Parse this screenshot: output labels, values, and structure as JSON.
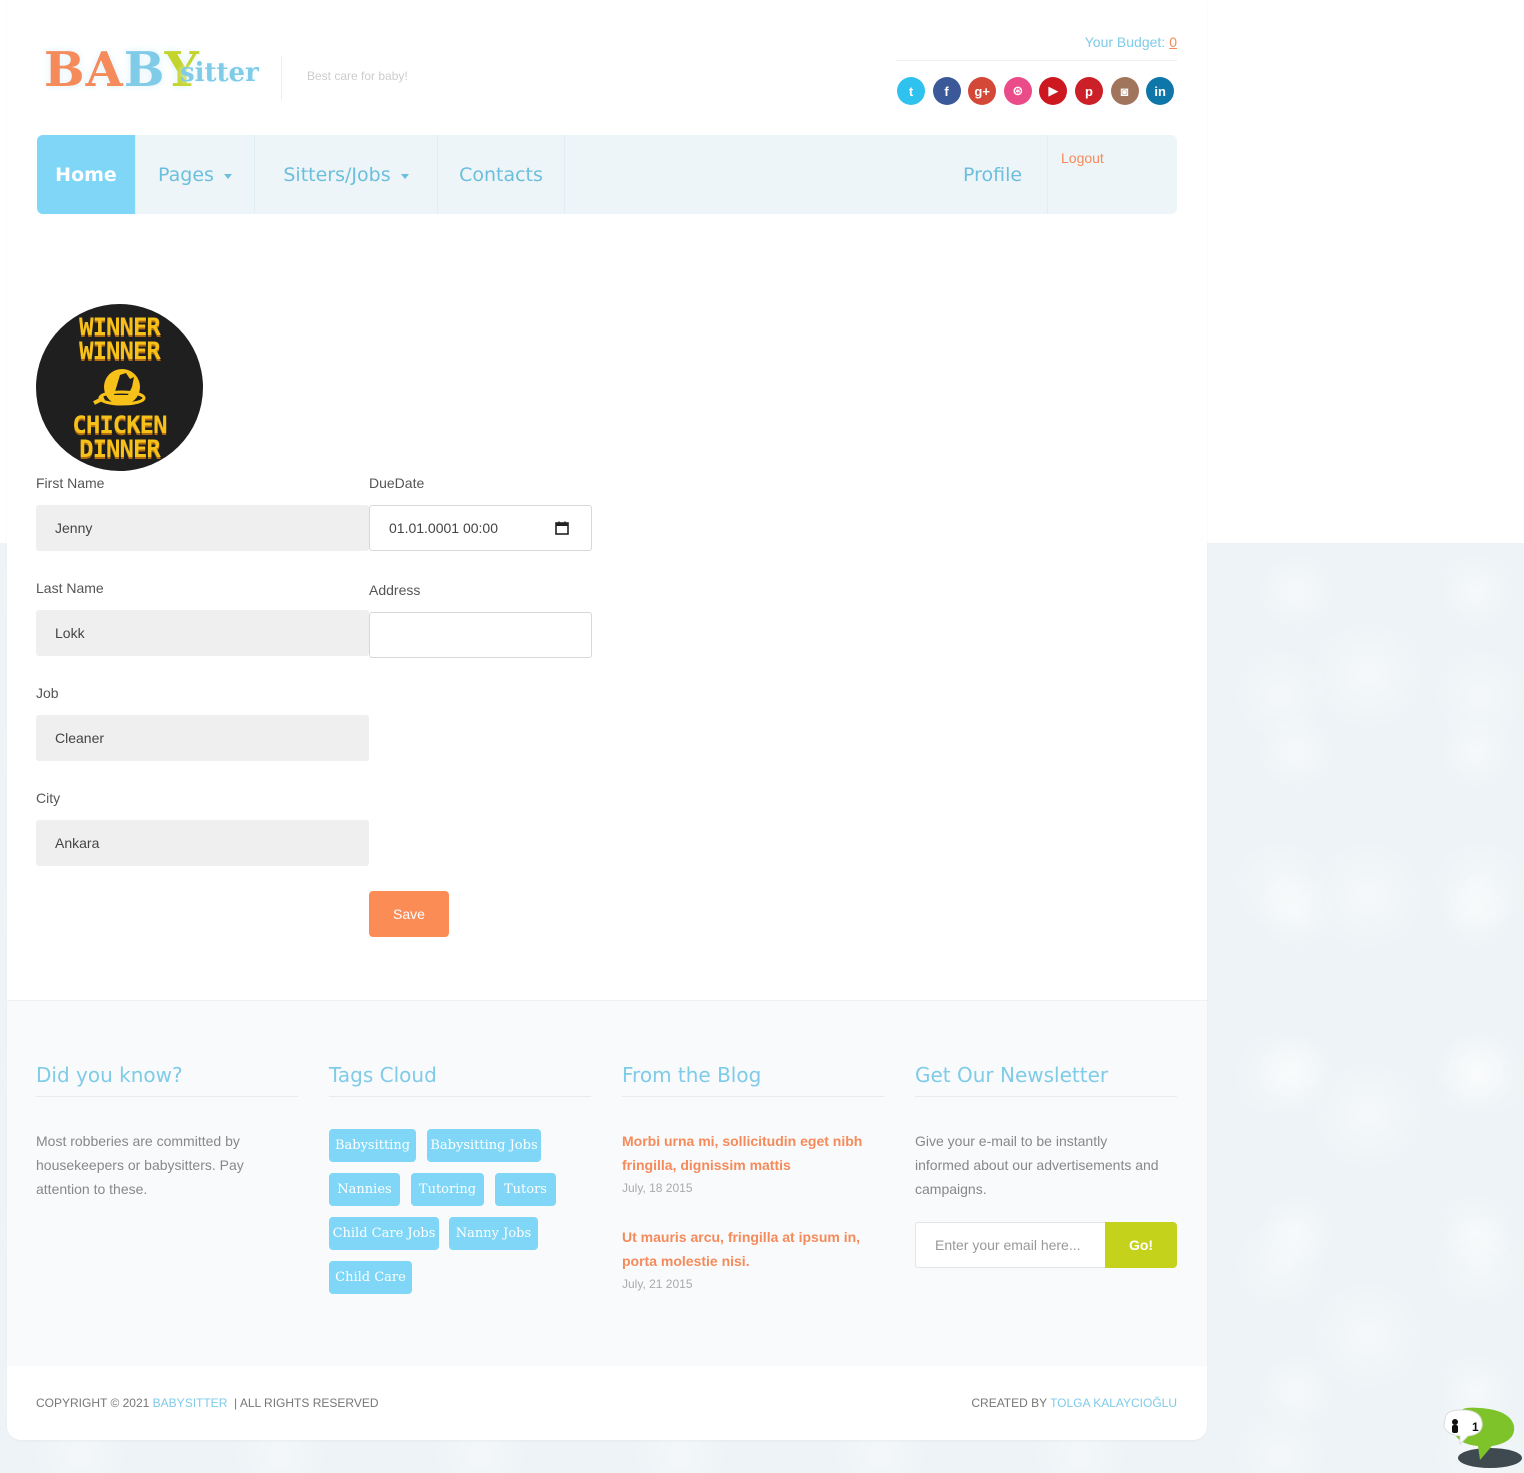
{
  "header": {
    "logo_part1": "B",
    "logo_part2": "A",
    "logo_part3": "B",
    "logo_part4": "Y",
    "logo_sub": "sitter",
    "tagline": "Best care for baby!",
    "budget_label": "Your Budget:",
    "budget_value": "0"
  },
  "socials": [
    {
      "icon": "twitter-icon",
      "glyph": "t",
      "color": "#2fc2ef"
    },
    {
      "icon": "facebook-icon",
      "glyph": "f",
      "color": "#3b5998"
    },
    {
      "icon": "google-plus-icon",
      "glyph": "g+",
      "color": "#d34836"
    },
    {
      "icon": "dribbble-icon",
      "glyph": "⊛",
      "color": "#ea4c89"
    },
    {
      "icon": "youtube-icon",
      "glyph": "▶",
      "color": "#cc181e"
    },
    {
      "icon": "pinterest-icon",
      "glyph": "p",
      "color": "#cb2027"
    },
    {
      "icon": "instagram-icon",
      "glyph": "◙",
      "color": "#a1755c"
    },
    {
      "icon": "linkedin-icon",
      "glyph": "in",
      "color": "#0e76a8"
    }
  ],
  "nav": {
    "home": "Home",
    "pages": "Pages",
    "sitters_jobs": "Sitters/Jobs",
    "contacts": "Contacts",
    "profile": "Profile",
    "logout": "Logout"
  },
  "avatar": {
    "line1": "WINNER",
    "line2": "WINNER",
    "line3": "CHICKEN",
    "line4": "DINNER"
  },
  "form": {
    "first_name_label": "First Name",
    "first_name_value": "Jenny",
    "last_name_label": "Last Name",
    "last_name_value": "Lokk",
    "job_label": "Job",
    "job_value": "Cleaner",
    "city_label": "City",
    "city_value": "Ankara",
    "due_date_label": "DueDate",
    "due_date_value": "01.01.0001 00:00",
    "address_label": "Address",
    "address_value": "",
    "save_label": "Save"
  },
  "footer": {
    "did_you_know_title": "Did you know?",
    "did_you_know_line1": "Most robberies are committed by",
    "did_you_know_line2": "housekeepers or babysitters. Pay",
    "did_you_know_line3": "attention to these.",
    "tags_title": "Tags Cloud",
    "tags": [
      "Babysitting",
      "Babysitting Jobs",
      "Nannies",
      "Tutoring",
      "Tutors",
      "Child Care Jobs",
      "Nanny Jobs",
      "Child Care"
    ],
    "blog_title": "From the Blog",
    "blog_posts": [
      {
        "line1": "Morbi urna mi, sollicitudin eget nibh",
        "line2": "fringilla, dignissim mattis",
        "date": "July, 18 2015"
      },
      {
        "line1": "Ut mauris arcu, fringilla at ipsum in,",
        "line2": "porta molestie nisi.",
        "date": "July, 21 2015"
      }
    ],
    "newsletter_title": "Get Our Newsletter",
    "newsletter_line1": "Give your e-mail to be instantly",
    "newsletter_line2": "informed about our advertisements and",
    "newsletter_line3": "campaigns.",
    "newsletter_placeholder": "Enter your email here...",
    "newsletter_button": "Go!"
  },
  "bottom": {
    "copyright_prefix": "COPYRIGHT © 2021",
    "copyright_brand": "BABYSITTER",
    "copyright_suffix": "|  ALL RIGHTS RESERVED",
    "created_prefix": "CREATED BY",
    "created_name": "TOLGA KALAYCIOĞLU"
  },
  "chat": {
    "count": "1"
  }
}
